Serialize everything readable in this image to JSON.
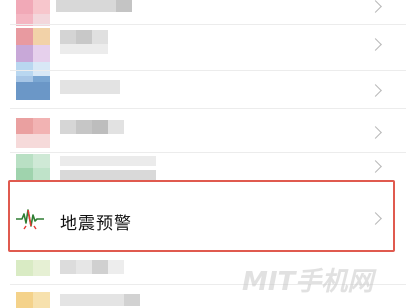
{
  "settings_list": {
    "highlighted_item": {
      "label": "地震预警",
      "icon": "seismograph-icon",
      "accent_color": "#e05a4f"
    }
  },
  "watermark": {
    "text": "MIT手机网",
    "color": "#c9c9c9"
  }
}
